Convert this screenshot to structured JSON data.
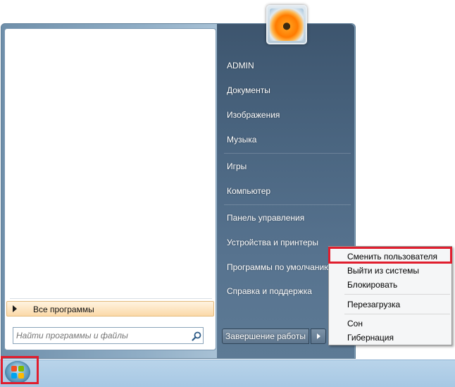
{
  "start_menu": {
    "all_programs_label": "Все программы",
    "search": {
      "placeholder": "Найти программы и файлы",
      "value": ""
    },
    "right_items": [
      "ADMIN",
      "Документы",
      "Изображения",
      "Музыка",
      "Игры",
      "Компьютер",
      "Панель управления",
      "Устройства и принтеры",
      "Программы по умолчанию",
      "Справка и поддержка"
    ],
    "shutdown_label": "Завершение работы"
  },
  "context_menu": {
    "items": [
      "Сменить пользователя",
      "Выйти из системы",
      "Блокировать",
      "Перезагрузка",
      "Сон",
      "Гибернация"
    ]
  },
  "icons": {
    "user_picture": "flower-avatar",
    "search": "search-icon",
    "start": "windows-start-orb"
  },
  "colors": {
    "highlight": "#e01e2e",
    "right_pane": "#4a6580",
    "taskbar": "#b9d4ea"
  }
}
